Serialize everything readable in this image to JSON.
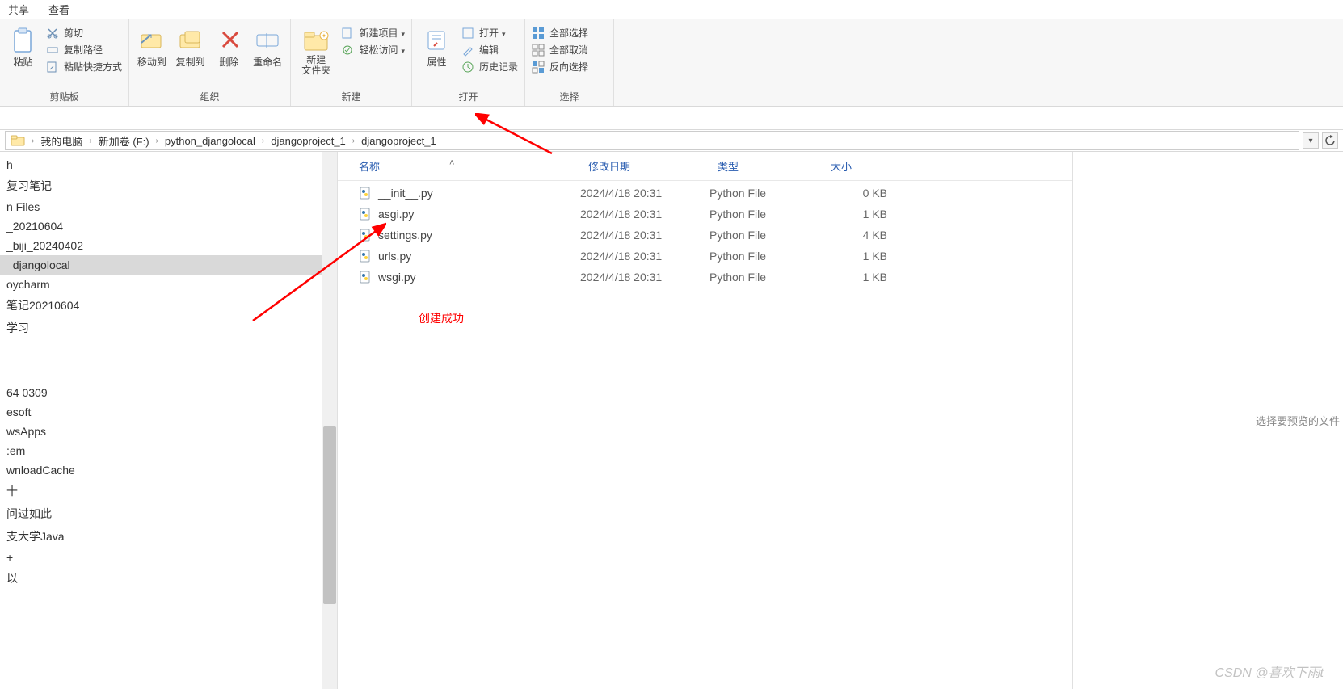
{
  "top_tabs": {
    "share": "共享",
    "view": "查看"
  },
  "ribbon": {
    "groups": {
      "clipboard": {
        "label": "剪贴板",
        "paste": "粘贴",
        "cut": "剪切",
        "copy_path": "复制路径",
        "paste_shortcut": "粘贴快捷方式"
      },
      "organize": {
        "label": "组织",
        "move_to": "移动到",
        "copy_to": "复制到",
        "delete": "删除",
        "rename": "重命名"
      },
      "new": {
        "label": "新建",
        "new_folder": "新建\n文件夹",
        "new_item": "新建项目",
        "easy_access": "轻松访问"
      },
      "open": {
        "label": "打开",
        "properties": "属性",
        "open": "打开",
        "edit": "编辑",
        "history": "历史记录"
      },
      "select": {
        "label": "选择",
        "select_all": "全部选择",
        "select_none": "全部取消",
        "invert": "反向选择"
      }
    }
  },
  "address": {
    "crumbs": [
      "我的电脑",
      "新加卷 (F:)",
      "python_djangolocal",
      "djangoproject_1",
      "djangoproject_1"
    ]
  },
  "sidebar": {
    "items_top": [
      "h",
      "复习笔记",
      "n Files",
      "_20210604",
      "_biji_20240402",
      "_djangolocal",
      "oycharm",
      "笔记20210604",
      "学习"
    ],
    "items_bottom": [
      "64 0309",
      "esoft",
      "wsApps",
      ":em",
      "wnloadCache",
      "十",
      "问过如此",
      "支大学Java",
      "+",
      "以"
    ],
    "selected_index": 5
  },
  "columns": {
    "name": "名称",
    "date": "修改日期",
    "type": "类型",
    "size": "大小"
  },
  "files": [
    {
      "name": "__init__.py",
      "date": "2024/4/18 20:31",
      "type": "Python File",
      "size": "0 KB"
    },
    {
      "name": "asgi.py",
      "date": "2024/4/18 20:31",
      "type": "Python File",
      "size": "1 KB"
    },
    {
      "name": "settings.py",
      "date": "2024/4/18 20:31",
      "type": "Python File",
      "size": "4 KB"
    },
    {
      "name": "urls.py",
      "date": "2024/4/18 20:31",
      "type": "Python File",
      "size": "1 KB"
    },
    {
      "name": "wsgi.py",
      "date": "2024/4/18 20:31",
      "type": "Python File",
      "size": "1 KB"
    }
  ],
  "annotation": "创建成功",
  "preview_placeholder": "选择要预览的文件",
  "watermark": "CSDN @喜欢下雨t"
}
